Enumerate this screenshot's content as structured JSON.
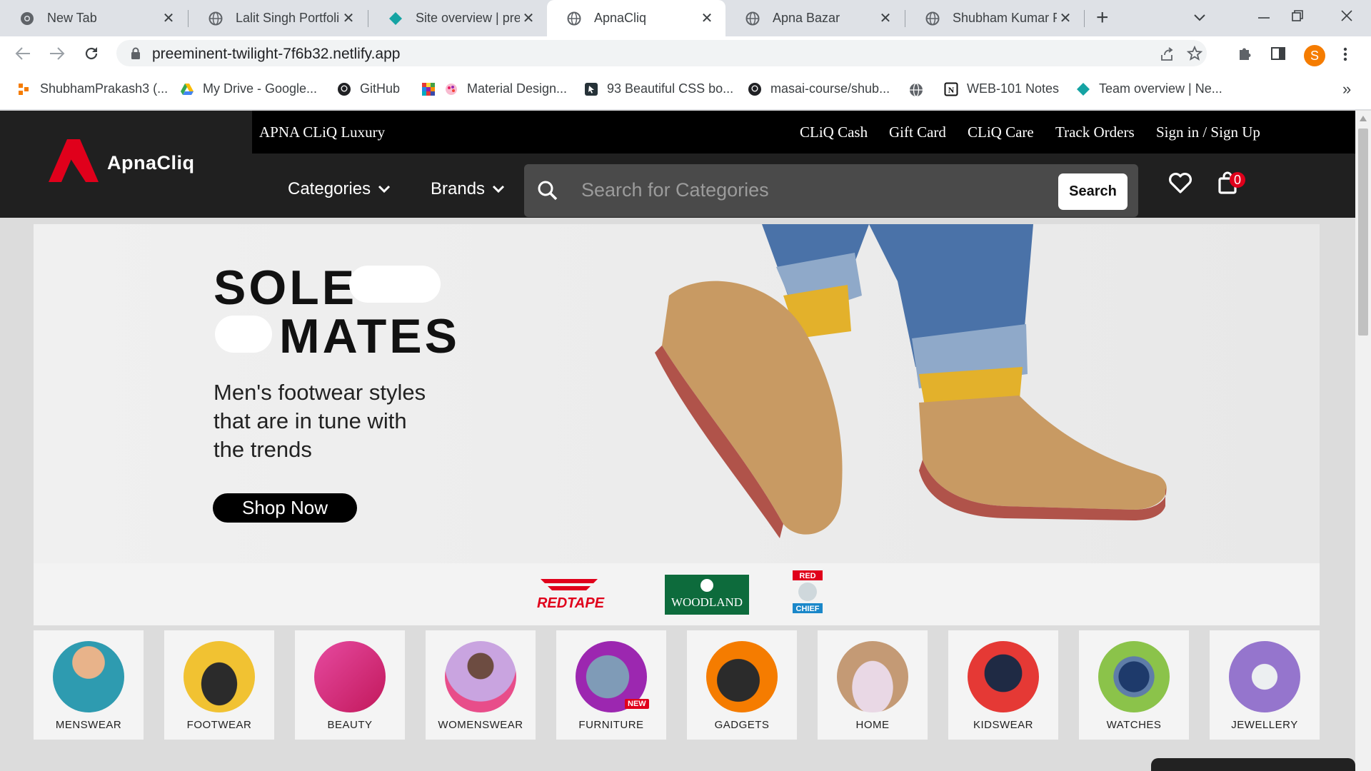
{
  "browser": {
    "tabs": [
      {
        "title": "New Tab"
      },
      {
        "title": "Lalit Singh Portfolio"
      },
      {
        "title": "Site overview | pree"
      },
      {
        "title": "ApnaCliq"
      },
      {
        "title": "Apna Bazar"
      },
      {
        "title": "Shubham Kumar Po"
      }
    ],
    "new_tab": "+",
    "url": "preeminent-twilight-7f6b32.netlify.app",
    "profile_initial": "S",
    "bookmarks": [
      {
        "label": "ShubhamPrakash3 (..."
      },
      {
        "label": "My Drive - Google..."
      },
      {
        "label": "GitHub"
      },
      {
        "label": "Material Design..."
      },
      {
        "label": "93 Beautiful CSS bo..."
      },
      {
        "label": "masai-course/shub..."
      },
      {
        "label": "WEB-101 Notes"
      },
      {
        "label": "Team overview | Ne..."
      }
    ],
    "more_bookmarks": "»"
  },
  "site": {
    "luxury": "APNA CLiQ Luxury",
    "top_links": [
      "CLiQ Cash",
      "Gift Card",
      "CLiQ Care",
      "Track Orders",
      "Sign in / Sign Up"
    ],
    "logo_text": "ApnaCliq",
    "menu": [
      "Categories",
      "Brands"
    ],
    "search_placeholder": "Search for Categories",
    "search_button": "Search",
    "cart_count": "0",
    "brand_color": "#e0001b"
  },
  "banner": {
    "line1": "SOLE",
    "line2": "MATES",
    "sub": [
      "Men's footwear styles",
      "that are in tune with",
      "the trends"
    ],
    "cta": "Shop Now"
  },
  "brands": [
    "REDTAPE",
    "WOODLAND",
    "RED",
    "CHIEF"
  ],
  "categories": [
    {
      "label": "MENSWEAR"
    },
    {
      "label": "FOOTWEAR"
    },
    {
      "label": "BEAUTY"
    },
    {
      "label": "WOMENSWEAR"
    },
    {
      "label": "FURNITURE"
    },
    {
      "label": "GADGETS"
    },
    {
      "label": "HOME"
    },
    {
      "label": "KIDSWEAR"
    },
    {
      "label": "WATCHES"
    },
    {
      "label": "JEWELLERY"
    }
  ],
  "furniture_badge": "NEW"
}
